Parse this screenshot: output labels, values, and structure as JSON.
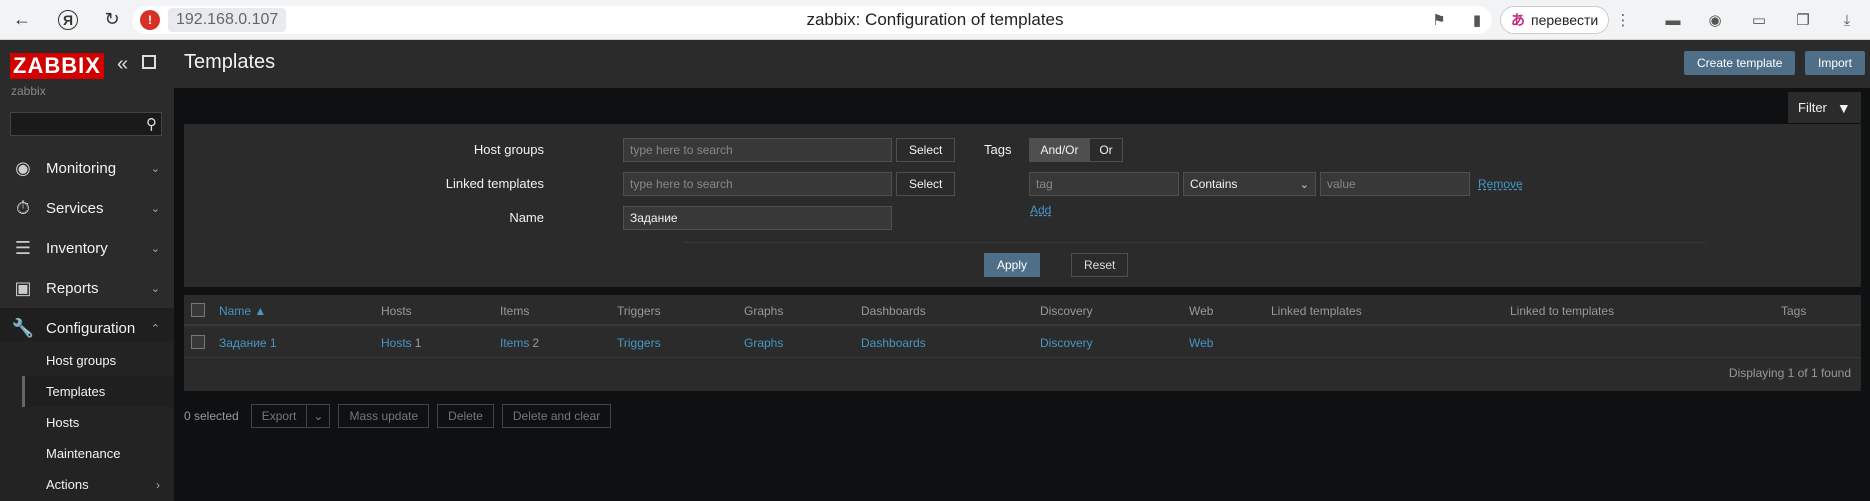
{
  "browser": {
    "url": "192.168.0.107",
    "title": "zabbix: Configuration of templates",
    "translate_label": "перевести"
  },
  "sidebar": {
    "logo": "ZABBIX",
    "server_name": "zabbix",
    "search_value": "",
    "menu": [
      {
        "label": "Monitoring",
        "icon": "eye-icon"
      },
      {
        "label": "Services",
        "icon": "timer-icon"
      },
      {
        "label": "Inventory",
        "icon": "list-icon"
      },
      {
        "label": "Reports",
        "icon": "bar-chart-icon"
      },
      {
        "label": "Configuration",
        "icon": "wrench-icon"
      }
    ],
    "submenu": [
      {
        "label": "Host groups"
      },
      {
        "label": "Templates"
      },
      {
        "label": "Hosts"
      },
      {
        "label": "Maintenance"
      },
      {
        "label": "Actions"
      }
    ]
  },
  "header": {
    "title": "Templates",
    "create_label": "Create template",
    "import_label": "Import"
  },
  "filter": {
    "tab_label": "Filter",
    "host_groups_label": "Host groups",
    "host_groups_placeholder": "type here to search",
    "linked_templates_label": "Linked templates",
    "linked_templates_placeholder": "type here to search",
    "name_label": "Name",
    "name_value": "Задание",
    "select_label": "Select",
    "tags_label": "Tags",
    "and_or_label": "And/Or",
    "or_label": "Or",
    "tag_placeholder": "tag",
    "operator_value": "Contains",
    "value_placeholder": "value",
    "remove_label": "Remove",
    "add_label": "Add",
    "apply_label": "Apply",
    "reset_label": "Reset"
  },
  "table": {
    "columns": [
      "Name ▲",
      "Hosts",
      "Items",
      "Triggers",
      "Graphs",
      "Dashboards",
      "Discovery",
      "Web",
      "Linked templates",
      "Linked to templates",
      "Tags"
    ],
    "rows": [
      {
        "name": "Задание 1",
        "hosts": "Hosts",
        "hosts_count": "1",
        "items": "Items",
        "items_count": "2",
        "triggers": "Triggers",
        "graphs": "Graphs",
        "dashboards": "Dashboards",
        "discovery": "Discovery",
        "web": "Web"
      }
    ],
    "found_text": "Displaying 1 of 1 found"
  },
  "bulk": {
    "selected_text": "0 selected",
    "export_label": "Export",
    "mass_update_label": "Mass update",
    "delete_label": "Delete",
    "delete_clear_label": "Delete and clear"
  }
}
